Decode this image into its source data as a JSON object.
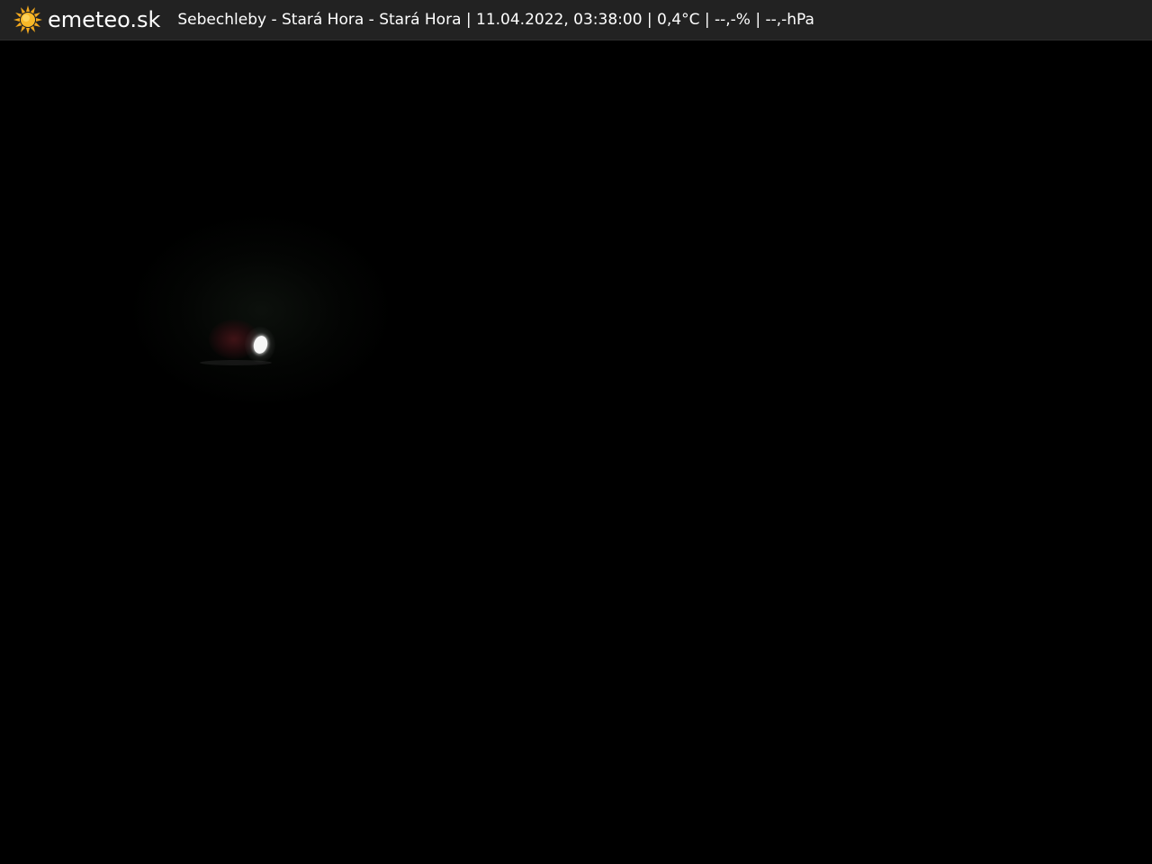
{
  "header": {
    "brand": "emeteo.sk",
    "caption": "Sebechleby - Stará Hora - Stará Hora | 11.04.2022, 03:38:00 | 0,4°C | --,-% | --,-hPa",
    "logo_icon": "sun-icon",
    "colors": {
      "bar_background": "#222222",
      "text": "#ffffff",
      "sun": "#f2a81d"
    }
  },
  "scene": {
    "description_icon": "light-spot",
    "background_color": "#000000"
  }
}
